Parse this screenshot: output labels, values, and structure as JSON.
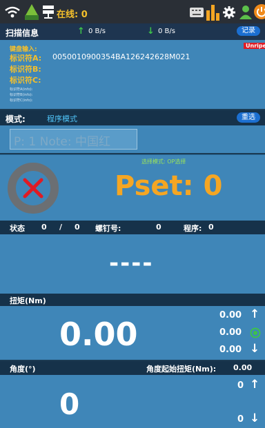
{
  "status_bar": {
    "online_label": "在线: 0"
  },
  "scan": {
    "title": "扫描信息",
    "upload_rate": "0 B/s",
    "download_rate": "0 B/s",
    "record_button": "记录",
    "keyboard_label": "键盘输入:",
    "id_a_label": "标识符A:",
    "id_a_value": "0050010900354BA126242628M021",
    "id_b_label": "标识符B:",
    "id_c_label": "标识符C:",
    "badge": "Unripe",
    "small_lines": [
      "标识符A(info):",
      "标识符B(info):",
      "标识符C(info):"
    ]
  },
  "mode": {
    "label": "模式:",
    "value": "程序模式",
    "reselect_button": "重选"
  },
  "program_field": {
    "value": "P: 1 Note: 中国红"
  },
  "pset": {
    "selection_mode": "选择模式: OP选择",
    "value_label": "Pset: 0"
  },
  "status_row": {
    "state_label": "状态",
    "count_done": "0",
    "slash": "/",
    "count_total": "0",
    "screw_label": "螺钉号:",
    "screw_value": "0",
    "program_label": "程序:",
    "program_value": "0"
  },
  "result": {
    "placeholder": "----"
  },
  "torque": {
    "title": "扭矩(Nm)",
    "value": "0.00",
    "upper": "0.00",
    "target": "0.00",
    "lower": "0.00"
  },
  "angle": {
    "title": "角度(°)",
    "start_torque_label": "角度起始扭矩(Nm):",
    "start_torque_value": "0.00",
    "value": "0",
    "upper": "0",
    "lower": "0"
  },
  "colors": {
    "panel": "#3f86b8",
    "dark": "#16324a",
    "accent": "#f5a623",
    "error": "#e01b24"
  }
}
